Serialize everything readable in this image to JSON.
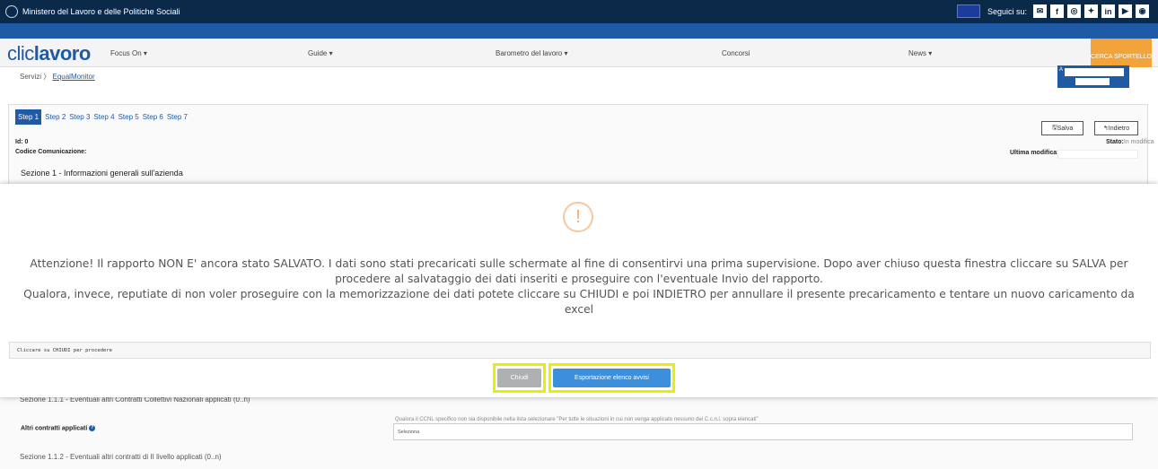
{
  "topbar": {
    "ministry": "Ministero del Lavoro e delle Politiche Sociali",
    "follow_label": "Seguici su:",
    "social_icons": [
      "mail-icon",
      "facebook-icon",
      "instagram-icon",
      "twitter-icon",
      "linkedin-icon",
      "youtube-icon",
      "rss-icon"
    ]
  },
  "nav": {
    "logo_light": "clic",
    "logo_bold": "lavoro",
    "items": [
      "Focus On ▾",
      "Guide ▾",
      "Barometro del lavoro ▾",
      "Concorsi",
      "News ▾"
    ],
    "cerca": "CERCA SPORTELLO"
  },
  "breadcrumb": {
    "servizi": "Servizi",
    "sep": "〉",
    "current": "EqualMonitor"
  },
  "user": {
    "label": "A"
  },
  "wizard": {
    "steps": [
      "Step 1",
      "Step 2",
      "Step 3",
      "Step 4",
      "Step 5",
      "Step 6",
      "Step 7"
    ],
    "save_label": "Salva",
    "back_label": "Indietro",
    "id_label": "Id: 0",
    "codice_label": "Codice Comunicazione:",
    "stato_label": "Stato:",
    "stato_value": "In modifica",
    "ultima_label": "Ultima modifica:",
    "section_title": "Sezione 1 - Informazioni generali sull'azienda"
  },
  "modal": {
    "icon": "!",
    "line1": "Attenzione! Il rapporto NON E' ancora stato SALVATO. I dati sono stati precaricati sulle schermate al fine di consentirvi una prima supervisione. Dopo aver chiuso questa finestra cliccare su SALVA per procedere al salvataggio dei dati inseriti e proseguire con l'eventuale Invio del rapporto.",
    "line2": "Qualora, invece, reputiate di non voler proseguire con la memorizzazione dei dati potete cliccare su CHIUDI e poi INDIETRO per annullare il presente precaricamento e tentare un nuovo caricamento da excel",
    "info": "Cliccare su CHIUDI per procedere",
    "chiudi_label": "Chiudi",
    "export_label": "Esportazione elenco avvisi"
  },
  "below": {
    "sub1": "Sezione 1.1.1 - Eventuali altri Contratti Collettivi Nazionali applicati (0..n)",
    "altri_label": "Altri contratti applicati",
    "hint": "Qualora il CCNL specifico non sia disponibile nella lista selezionare \"Per tutte le situazioni in cui non venga applicato nessuno dei C.c.n.l. sopra elencati\"",
    "select_value": "Seleziona",
    "sub2": "Sezione 1.1.2 - Eventuali altri contratti di II livello applicati (0..n)"
  },
  "colors": {
    "topbar": "#0b2a4a",
    "primary": "#1f5aa6",
    "cerca": "#f2a33a",
    "highlight": "#e6f000",
    "export_button": "#3c8fdc",
    "chiudi_button": "#aeb0b2"
  }
}
